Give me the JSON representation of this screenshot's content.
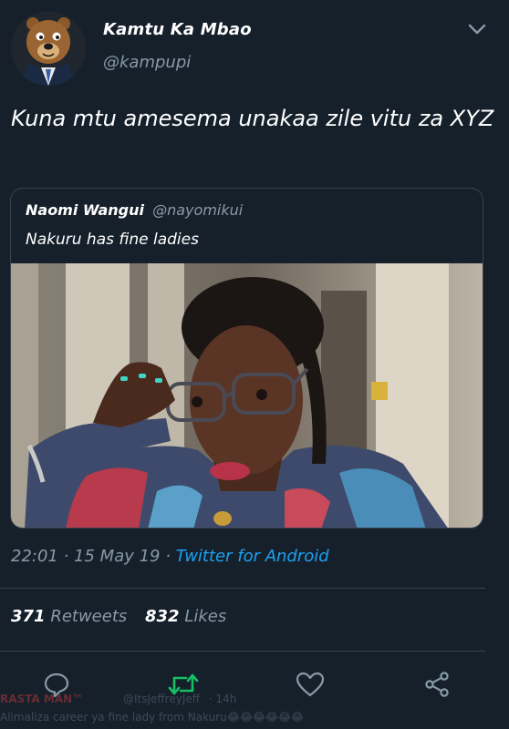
{
  "tweet": {
    "author_name": "Kamtu Ka Mbao",
    "author_handle": "@kampupi",
    "text": "Kuna mtu amesema unakaa zile vitu za XYZ",
    "quoted": {
      "author_name": "Naomi Wangui",
      "author_handle": "@nayomikui",
      "text": "Nakuru has fine ladies"
    },
    "timestamp": "22:01 · 15 May 19 · ",
    "source": "Twitter for Android",
    "retweets_count": "371",
    "retweets_label": "Retweets",
    "likes_count": "832",
    "likes_label": "Likes"
  },
  "actions": {
    "reply": "reply-icon",
    "retweet": "retweet-icon",
    "like": "heart-icon",
    "share": "share-icon"
  },
  "background_overlay": {
    "name": "RASTA MAN™",
    "handle": "@ItsJeffreyJeff",
    "time": "· 14h",
    "text": "Alimaliza career ya fine lady from Nakuru😂😂😂😂😂😂"
  },
  "colors": {
    "background": "#15202b",
    "text": "#ffffff",
    "muted": "#8899a6",
    "link": "#1da1f2",
    "retweet": "#17bf63",
    "border": "#38444d"
  }
}
